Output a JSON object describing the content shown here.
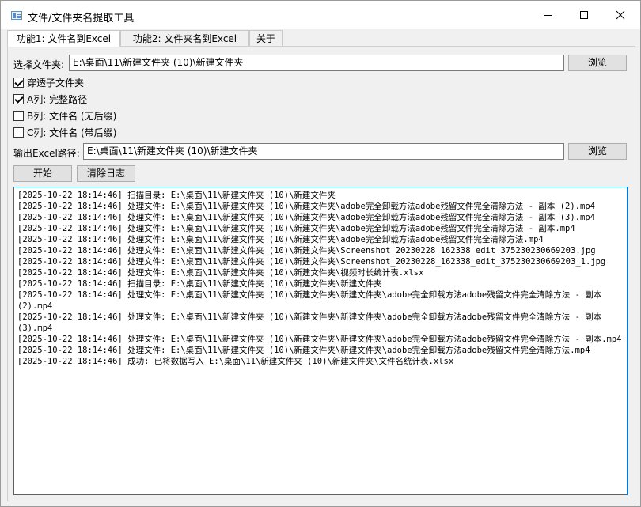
{
  "window": {
    "title": "文件/文件夹名提取工具",
    "icon": "app-window-icon",
    "controls": [
      "minimize-icon",
      "maximize-icon",
      "close-icon"
    ]
  },
  "tabs": [
    {
      "label": "功能1: 文件名到Excel",
      "active": true
    },
    {
      "label": "功能2: 文件夹名到Excel",
      "active": false
    },
    {
      "label": "关于",
      "active": false
    }
  ],
  "form": {
    "folder_label": "选择文件夹:",
    "folder_value": "E:\\桌面\\11\\新建文件夹 (10)\\新建文件夹",
    "browse_label": "浏览",
    "output_label": "输出Excel路径:",
    "output_value": "E:\\桌面\\11\\新建文件夹 (10)\\新建文件夹",
    "output_browse_label": "浏览",
    "checkboxes": [
      {
        "label": "穿透子文件夹",
        "checked": true
      },
      {
        "label": "A列: 完整路径",
        "checked": true
      },
      {
        "label": "B列: 文件名 (无后缀)",
        "checked": false
      },
      {
        "label": "C列: 文件名 (带后缀)",
        "checked": false
      }
    ],
    "start_label": "开始",
    "clear_label": "清除日志"
  },
  "log": {
    "accent_color": "#0078d7",
    "lines": [
      "[2025-10-22 18:14:46] 扫描目录: E:\\桌面\\11\\新建文件夹 (10)\\新建文件夹",
      "[2025-10-22 18:14:46] 处理文件: E:\\桌面\\11\\新建文件夹 (10)\\新建文件夹\\adobe完全卸载方法adobe残留文件完全清除方法 - 副本 (2).mp4",
      "[2025-10-22 18:14:46] 处理文件: E:\\桌面\\11\\新建文件夹 (10)\\新建文件夹\\adobe完全卸载方法adobe残留文件完全清除方法 - 副本 (3).mp4",
      "[2025-10-22 18:14:46] 处理文件: E:\\桌面\\11\\新建文件夹 (10)\\新建文件夹\\adobe完全卸载方法adobe残留文件完全清除方法 - 副本.mp4",
      "[2025-10-22 18:14:46] 处理文件: E:\\桌面\\11\\新建文件夹 (10)\\新建文件夹\\adobe完全卸载方法adobe残留文件完全清除方法.mp4",
      "[2025-10-22 18:14:46] 处理文件: E:\\桌面\\11\\新建文件夹 (10)\\新建文件夹\\Screenshot_20230228_162338_edit_375230230669203.jpg",
      "[2025-10-22 18:14:46] 处理文件: E:\\桌面\\11\\新建文件夹 (10)\\新建文件夹\\Screenshot_20230228_162338_edit_375230230669203_1.jpg",
      "[2025-10-22 18:14:46] 处理文件: E:\\桌面\\11\\新建文件夹 (10)\\新建文件夹\\视频时长统计表.xlsx",
      "[2025-10-22 18:14:46] 扫描目录: E:\\桌面\\11\\新建文件夹 (10)\\新建文件夹\\新建文件夹",
      "[2025-10-22 18:14:46] 处理文件: E:\\桌面\\11\\新建文件夹 (10)\\新建文件夹\\新建文件夹\\adobe完全卸载方法adobe残留文件完全清除方法 - 副本 (2).mp4",
      "[2025-10-22 18:14:46] 处理文件: E:\\桌面\\11\\新建文件夹 (10)\\新建文件夹\\新建文件夹\\adobe完全卸载方法adobe残留文件完全清除方法 - 副本 (3).mp4",
      "[2025-10-22 18:14:46] 处理文件: E:\\桌面\\11\\新建文件夹 (10)\\新建文件夹\\新建文件夹\\adobe完全卸载方法adobe残留文件完全清除方法 - 副本.mp4",
      "[2025-10-22 18:14:46] 处理文件: E:\\桌面\\11\\新建文件夹 (10)\\新建文件夹\\新建文件夹\\adobe完全卸载方法adobe残留文件完全清除方法.mp4",
      "[2025-10-22 18:14:46] 成功: 已将数据写入 E:\\桌面\\11\\新建文件夹 (10)\\新建文件夹\\文件名统计表.xlsx"
    ]
  }
}
